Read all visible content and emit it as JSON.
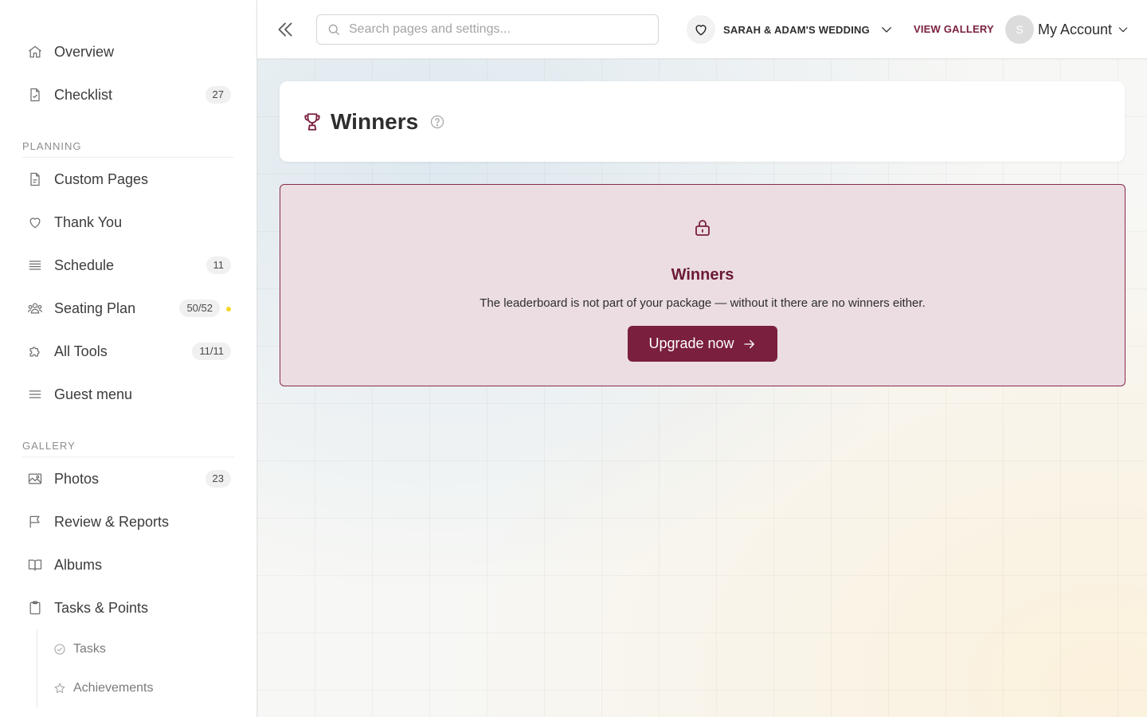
{
  "sidebar": {
    "top_items": [
      {
        "label": "Overview",
        "icon": "home-icon"
      },
      {
        "label": "Checklist",
        "icon": "checklist-icon",
        "badge": "27"
      }
    ],
    "sections": {
      "planning": "PLANNING",
      "gallery": "GALLERY"
    },
    "planning_items": [
      {
        "label": "Custom Pages",
        "icon": "page-icon"
      },
      {
        "label": "Thank You",
        "icon": "heart-icon"
      },
      {
        "label": "Schedule",
        "icon": "schedule-icon",
        "badge": "11"
      },
      {
        "label": "Seating Plan",
        "icon": "people-icon",
        "badge": "50/52",
        "dot_color": "#f5d72a"
      },
      {
        "label": "All Tools",
        "icon": "puzzle-icon",
        "badge": "11/11"
      },
      {
        "label": "Guest menu",
        "icon": "menu-icon"
      }
    ],
    "gallery_items": [
      {
        "label": "Photos",
        "icon": "image-icon",
        "badge": "23"
      },
      {
        "label": "Review & Reports",
        "icon": "flag-icon"
      },
      {
        "label": "Albums",
        "icon": "book-icon"
      },
      {
        "label": "Tasks & Points",
        "icon": "clipboard-icon"
      }
    ],
    "sub_items": [
      {
        "label": "Tasks",
        "icon": "check-circle-icon"
      },
      {
        "label": "Achievements",
        "icon": "star-icon"
      }
    ]
  },
  "topbar": {
    "search_placeholder": "Search pages and settings...",
    "event_name": "SARAH & ADAM'S WEDDING",
    "view_gallery": "VIEW GALLERY",
    "avatar_initial": "S",
    "account_label": "My Account"
  },
  "page": {
    "title": "Winners"
  },
  "locked": {
    "heading": "Winners",
    "message": "The leaderboard is not part of your package — without it there are no winners either.",
    "button": "Upgrade now"
  },
  "colors": {
    "accent": "#7a1f3d",
    "locked_bg": "#ebdde2",
    "badge_dot": "#f5d72a"
  }
}
